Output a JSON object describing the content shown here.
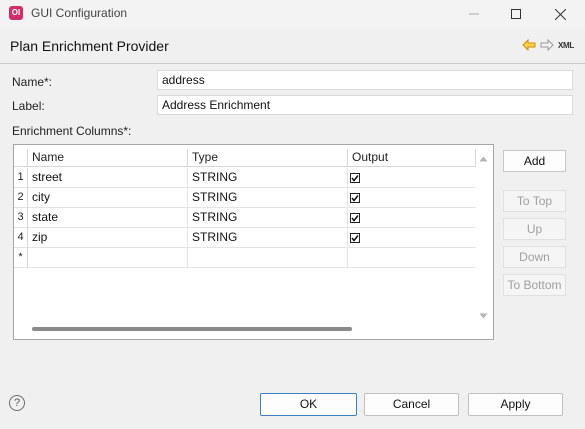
{
  "window": {
    "app_icon": "OI",
    "title": "GUI Configuration"
  },
  "header": {
    "title": "Plan Enrichment Provider",
    "xml_label": "XML"
  },
  "form": {
    "name_label": "Name*:",
    "name_value": "address",
    "label_label": "Label:",
    "label_value": "Address Enrichment",
    "columns_label": "Enrichment Columns*:"
  },
  "table": {
    "headers": [
      "Name",
      "Type",
      "Output"
    ],
    "rows": [
      {
        "index": "1",
        "name": "street",
        "type": "STRING",
        "output": true
      },
      {
        "index": "2",
        "name": "city",
        "type": "STRING",
        "output": true
      },
      {
        "index": "3",
        "name": "state",
        "type": "STRING",
        "output": true
      },
      {
        "index": "4",
        "name": "zip",
        "type": "STRING",
        "output": true
      }
    ],
    "new_row_marker": "*"
  },
  "side_buttons": {
    "add": "Add",
    "to_top": "To Top",
    "up": "Up",
    "down": "Down",
    "to_bottom": "To Bottom"
  },
  "footer": {
    "help": "?",
    "ok": "OK",
    "cancel": "Cancel",
    "apply": "Apply"
  },
  "colors": {
    "app_icon": "#d12d6b",
    "nav_arrow": "#e6a817",
    "primary_border": "#3b80c7"
  },
  "icons": [
    "minimize-icon",
    "maximize-icon",
    "close-icon",
    "back-arrow-icon",
    "forward-arrow-icon",
    "help-icon",
    "scroll-up-icon",
    "scroll-down-icon",
    "checkbox-icon"
  ]
}
